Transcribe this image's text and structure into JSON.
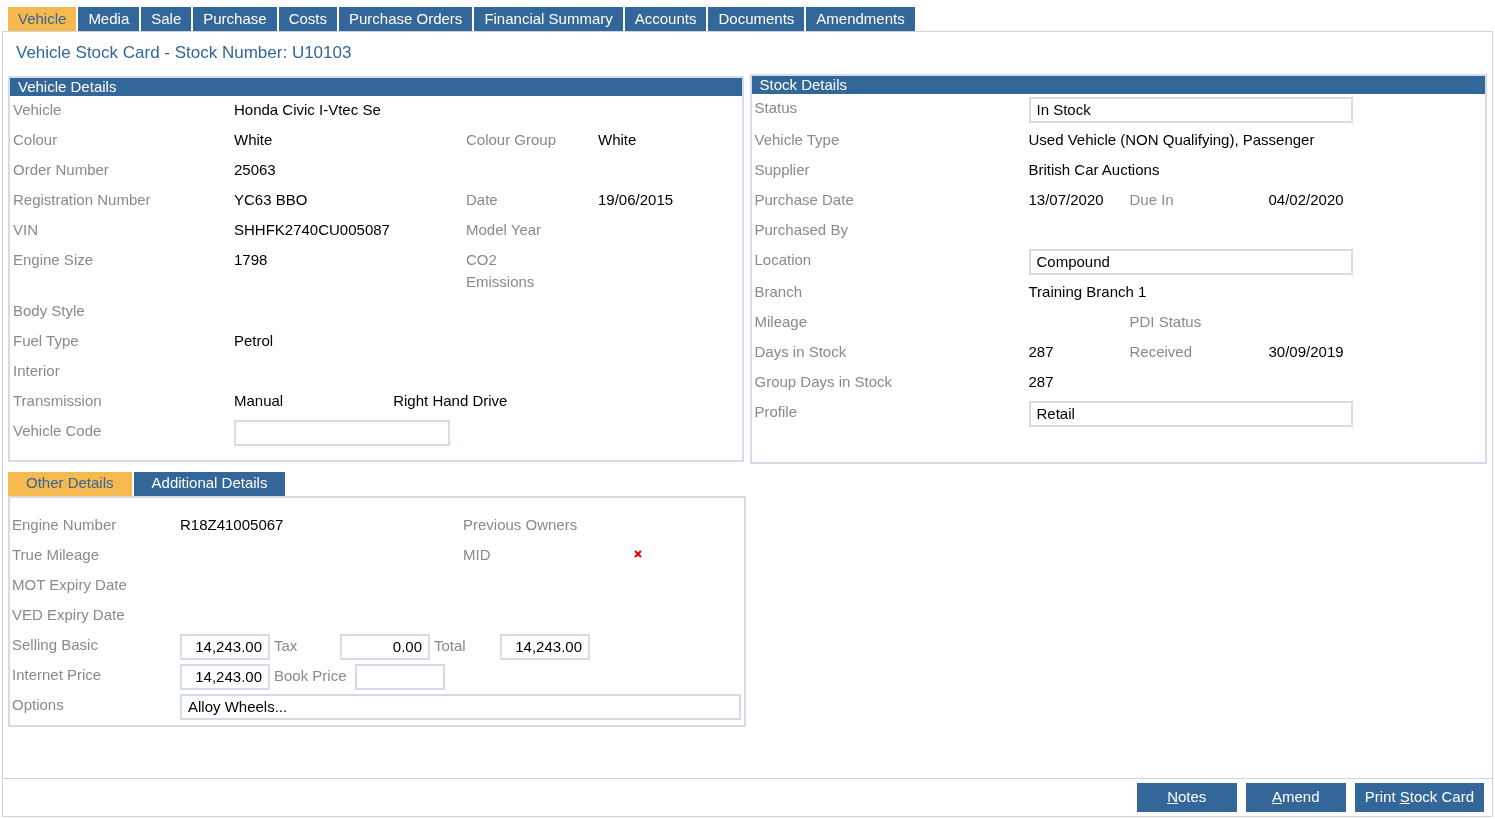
{
  "tabs": [
    {
      "label": "Vehicle",
      "selected": true
    },
    {
      "label": "Media",
      "selected": false
    },
    {
      "label": "Sale",
      "selected": false
    },
    {
      "label": "Purchase",
      "selected": false
    },
    {
      "label": "Costs",
      "selected": false
    },
    {
      "label": "Purchase Orders",
      "selected": false
    },
    {
      "label": "Financial Summary",
      "selected": false
    },
    {
      "label": "Accounts",
      "selected": false
    },
    {
      "label": "Documents",
      "selected": false
    },
    {
      "label": "Amendments",
      "selected": false
    }
  ],
  "title": "Vehicle Stock Card - Stock Number: U10103",
  "vehicle_details": {
    "title": "Vehicle Details",
    "rows": [
      {
        "label": "Vehicle",
        "value": "Honda Civic I-Vtec Se"
      },
      {
        "label": "Colour",
        "value": "White",
        "label2": "Colour Group",
        "value2": "White"
      },
      {
        "label": "Order Number",
        "value": "25063"
      },
      {
        "label": "Registration Number",
        "value": "YC63 BBO",
        "label2": "Date",
        "value2": "19/06/2015"
      },
      {
        "label": "VIN",
        "value": "SHHFK2740CU005087",
        "label2": "Model Year"
      },
      {
        "label": "Engine Size",
        "value": "1798",
        "label2": "CO2 Emissions"
      },
      {
        "label": "Body Style"
      },
      {
        "label": "Fuel Type",
        "value": "Petrol"
      },
      {
        "label": "Interior"
      },
      {
        "label": "Transmission",
        "value": "Manual",
        "note": "Right Hand Drive"
      },
      {
        "label": "Vehicle Code",
        "kind": "input"
      }
    ]
  },
  "stock_details": {
    "title": "Stock Details",
    "rows": [
      {
        "label": "Status",
        "kind": "input",
        "value": "In Stock"
      },
      {
        "label": "Vehicle Type",
        "value": "Used Vehicle (NON Qualifying), Passenger"
      },
      {
        "label": "Supplier",
        "value": "British Car Auctions"
      },
      {
        "label": "Purchase Date",
        "value": "13/07/2020",
        "label2": "Due In",
        "value2": "04/02/2020"
      },
      {
        "label": "Purchased By"
      },
      {
        "label": "Location",
        "kind": "input",
        "value": "Compound"
      },
      {
        "label": "Branch",
        "value": "Training Branch 1"
      },
      {
        "label": "Mileage",
        "label2": "PDI Status"
      },
      {
        "label": "Days in Stock",
        "value": "287",
        "label2": "Received",
        "value2": "30/09/2019"
      },
      {
        "label": "Group Days in Stock",
        "value": "287"
      },
      {
        "label": "Profile",
        "kind": "input",
        "value": "Retail"
      }
    ]
  },
  "sub_tabs": [
    {
      "label": "Other Details",
      "selected": true
    },
    {
      "label": "Additional Details",
      "selected": false
    }
  ],
  "other_details": {
    "rows": [
      {
        "label": "Engine Number",
        "kind": "pair",
        "value": "R18Z41005067",
        "label2": "Previous Owners"
      },
      {
        "label": "True Mileage",
        "kind": "pair",
        "label2": "MID",
        "warning": true
      },
      {
        "label": "MOT Expiry Date",
        "kind": "pair"
      },
      {
        "label": "VED Expiry Date",
        "kind": "pair"
      },
      {
        "label": "Selling Basic",
        "kind": "prices",
        "items": [
          {
            "kind": "input",
            "value": "14,243.00"
          },
          {
            "kind": "label",
            "text": "Tax"
          },
          {
            "kind": "input",
            "value": "0.00"
          },
          {
            "kind": "label",
            "text": "Total"
          },
          {
            "kind": "input",
            "value": "14,243.00"
          }
        ]
      },
      {
        "label": "Internet Price",
        "kind": "prices",
        "items": [
          {
            "kind": "input",
            "value": "14,243.00"
          },
          {
            "kind": "label",
            "text": "Book Price"
          },
          {
            "kind": "input"
          }
        ]
      },
      {
        "label": "Options",
        "kind": "wide_input",
        "value": "Alloy Wheels..."
      }
    ]
  },
  "buttons": [
    {
      "key": "N",
      "after": "otes"
    },
    {
      "key": "A",
      "after": "mend"
    },
    {
      "before": "Print ",
      "key": "S",
      "after": "tock Card"
    }
  ]
}
